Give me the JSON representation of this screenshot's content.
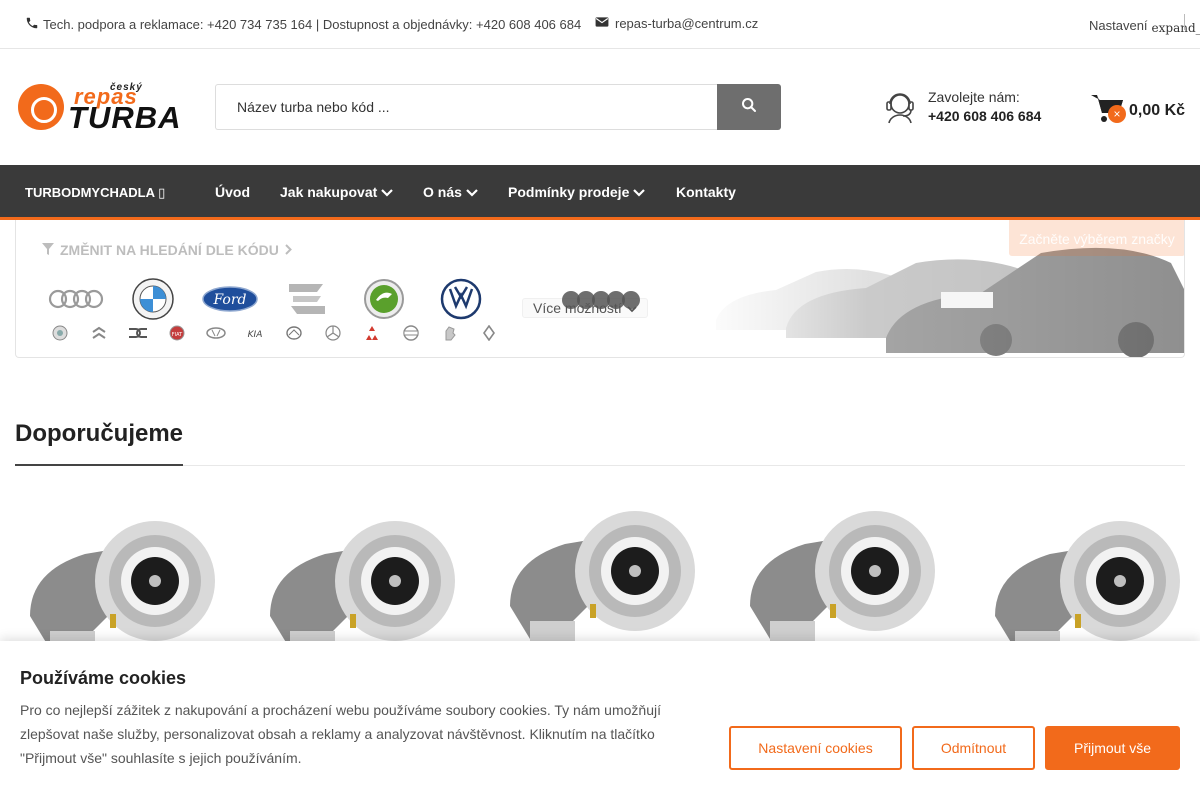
{
  "topbar": {
    "contact_text": "Tech. podpora a reklamace: +420 734 735 164 | Dostupnost a objednávky: +420 608 406 684",
    "email": "repas-turba@centrum.cz",
    "settings_label": "Nastavení",
    "settings_icon_text": "expand_"
  },
  "logo": {
    "small": "český",
    "brand_top": "repas",
    "brand_bottom": "TURBA"
  },
  "search": {
    "placeholder": "Název turba nebo kód ..."
  },
  "call": {
    "label": "Zavolejte nám:",
    "phone": "+420 608 406 684"
  },
  "cart": {
    "badge": "×",
    "total": "0,00 Kč"
  },
  "nav": {
    "category": "TURBODMYCHADLA",
    "items": [
      "Úvod",
      "Jak nakupovat",
      "O nás",
      "Podmínky prodeje",
      "Kontakty"
    ]
  },
  "brand_panel": {
    "switch_label": "ZMĚNIT NA HLEDÁNÍ DLE KÓDU",
    "cta": "Začněte výběrem značky",
    "more_label": "Více možností",
    "main_brands": [
      "Audi",
      "BMW",
      "Ford",
      "Seat",
      "Škoda",
      "Volkswagen"
    ],
    "mini_brands": [
      "Alfa Romeo",
      "Citroën",
      "Dacia",
      "Fiat",
      "Hyundai",
      "Kia",
      "Mazda",
      "Mercedes-Benz",
      "Mitsubishi",
      "Nissan",
      "Peugeot",
      "Renault"
    ]
  },
  "recommended": {
    "title": "Doporučujeme",
    "product_count_visible": 5
  },
  "cookie": {
    "title": "Používáme cookies",
    "text": "Pro co nejlepší zážitek z nakupování a procházení webu používáme soubory cookies. Ty nám umožňují zlepšovat naše služby, personalizovat obsah a reklamy a analyzovat návštěvnost. Kliknutím na tlačítko \"Přijmout vše\" souhlasíte s jejich používáním.",
    "settings_button": "Nastavení cookies",
    "reject_button": "Odmítnout",
    "accept_button": "Přijmout vše"
  },
  "colors": {
    "accent": "#f26a1b",
    "nav_bg": "#3a3a3a",
    "search_button": "#6e6e6e"
  }
}
